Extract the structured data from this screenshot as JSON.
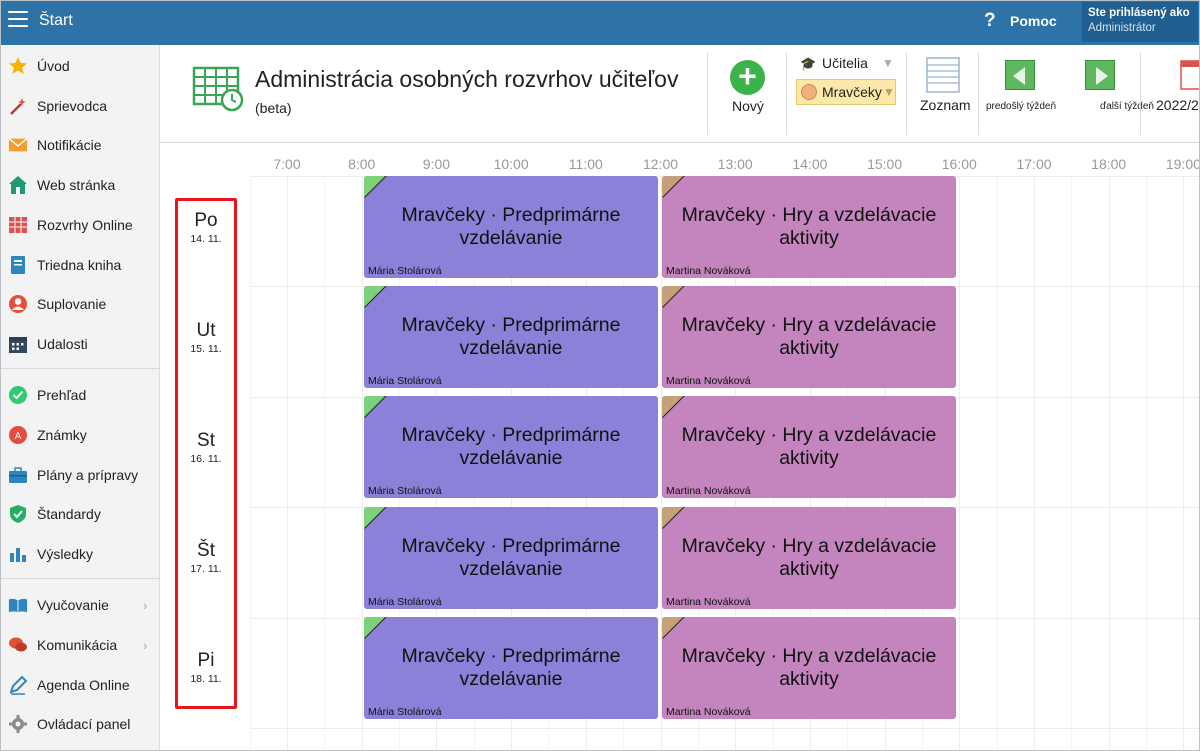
{
  "app": {
    "title": "Štart"
  },
  "help": {
    "icon": "question-icon",
    "label": "Pomoc"
  },
  "user": {
    "line1": "Ste prihlásený ako",
    "line2": "Administrátor"
  },
  "sidebar": {
    "items": [
      {
        "label": "Úvod",
        "icon": "star-icon"
      },
      {
        "label": "Sprievodca",
        "icon": "magic-wand-icon"
      },
      {
        "label": "Notifikácie",
        "icon": "envelope-icon"
      },
      {
        "label": "Web stránka",
        "icon": "house-icon"
      },
      {
        "label": "Rozvrhy Online",
        "icon": "timetable-icon"
      },
      {
        "label": "Triedna kniha",
        "icon": "notebook-icon"
      },
      {
        "label": "Suplovanie",
        "icon": "person-icon"
      },
      {
        "label": "Udalosti",
        "icon": "calendar-icon"
      },
      {
        "label": "Prehľad",
        "icon": "check-circle-icon"
      },
      {
        "label": "Známky",
        "icon": "grade-icon"
      },
      {
        "label": "Plány a prípravy",
        "icon": "briefcase-icon"
      },
      {
        "label": "Štandardy",
        "icon": "shield-icon"
      },
      {
        "label": "Výsledky",
        "icon": "bar-chart-icon"
      },
      {
        "label": "Vyučovanie",
        "icon": "book-icon",
        "chevron": "›"
      },
      {
        "label": "Komunikácia",
        "icon": "chat-icon",
        "chevron": "›"
      },
      {
        "label": "Agenda Online",
        "icon": "pencil-icon"
      },
      {
        "label": "Ovládací panel",
        "icon": "gear-icon"
      }
    ]
  },
  "header": {
    "title": "Administrácia osobných rozvrhov učiteľov",
    "subtitle": "(beta)",
    "new_label": "Nový",
    "new_symbol": "+",
    "teachers_select": "Učitelia",
    "class_select": "Mravčeky",
    "list_label": "Zoznam",
    "prev_week": "predošlý týždeň",
    "next_week": "ďalší týždeň",
    "year": "2022/2"
  },
  "timetable": {
    "hours": [
      "7:00",
      "8:00",
      "9:00",
      "10:00",
      "11:00",
      "12:00",
      "13:00",
      "14:00",
      "15:00",
      "16:00",
      "17:00",
      "18:00",
      "19:00"
    ],
    "days": [
      {
        "name": "Po",
        "date": "14. 11."
      },
      {
        "name": "Ut",
        "date": "15. 11."
      },
      {
        "name": "St",
        "date": "16. 11."
      },
      {
        "name": "Št",
        "date": "17. 11."
      },
      {
        "name": "Pi",
        "date": "18. 11."
      }
    ],
    "lesson_a": {
      "title": "Mravčeky · Predprimárne vzdelávanie",
      "teacher": "Mária Stolárová",
      "color": "#8b81d8",
      "start": "8:00",
      "end": "12:00"
    },
    "lesson_b": {
      "title": "Mravčeky · Hry a vzdelávacie aktivity",
      "teacher": "Martina Nováková",
      "color": "#c484bd",
      "start": "12:00",
      "end": "16:00"
    }
  },
  "colors": {
    "topbar": "#2e73a8",
    "highlight_box": "#e8161b",
    "new_button": "#3bb34a"
  }
}
